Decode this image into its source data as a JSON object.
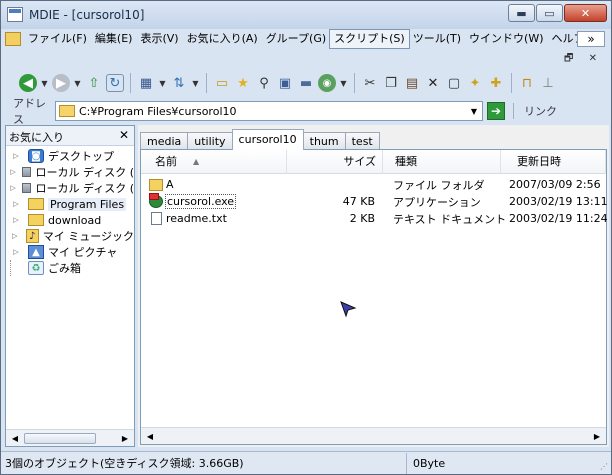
{
  "window": {
    "title": "MDIE - [cursorol10]",
    "buttons": {
      "minimize": "▬",
      "maximize": "▭",
      "close": "✕"
    }
  },
  "menu": {
    "items": [
      "ファイル(F)",
      "編集(E)",
      "表示(V)",
      "お気に入り(A)",
      "グループ(G)",
      "スクリプト(S)",
      "ツール(T)",
      "ウインドウ(W)",
      "ヘルプ(H)"
    ],
    "active_index": 5,
    "chevron": "»",
    "sub_buttons": "🗗 ✕"
  },
  "toolbar": {
    "icons": [
      "back-icon",
      "forward-icon",
      "up-folder-icon",
      "refresh-icon",
      "view-icon",
      "sort-icon",
      "folder-icon",
      "favorite-star-icon",
      "search-icon",
      "thumbnail-icon",
      "drive-icon",
      "network-icon",
      "cut-icon",
      "copy-icon",
      "paste-icon",
      "delete-icon",
      "properties-icon",
      "new-folder-icon",
      "bookmark-icon",
      "lock-icon",
      "pin-icon"
    ]
  },
  "address": {
    "label": "アドレス",
    "value": "C:¥Program Files¥cursorol10",
    "link_label": "リンク"
  },
  "left_pane": {
    "title": "お気に入り",
    "close": "✕",
    "tree": [
      {
        "label": "デスクトップ",
        "icon": "desktop-icon",
        "expandable": true
      },
      {
        "label": "ローカル ディスク (",
        "icon": "drive-icon",
        "expandable": true
      },
      {
        "label": "ローカル ディスク (",
        "icon": "drive-icon",
        "expandable": true
      },
      {
        "label": "Program Files",
        "icon": "folder-icon",
        "expandable": true,
        "selected": true
      },
      {
        "label": "download",
        "icon": "folder-icon",
        "expandable": true
      },
      {
        "label": "マイ ミュージック",
        "icon": "music-folder-icon",
        "expandable": true
      },
      {
        "label": "マイ ピクチャ",
        "icon": "picture-folder-icon",
        "expandable": true
      },
      {
        "label": "ごみ箱",
        "icon": "recycle-bin-icon",
        "expandable": false
      }
    ]
  },
  "tabs": [
    {
      "label": "media",
      "active": false
    },
    {
      "label": "utility",
      "active": false
    },
    {
      "label": "cursorol10",
      "active": true
    },
    {
      "label": "thum",
      "active": false
    },
    {
      "label": "test",
      "active": false
    }
  ],
  "file_list": {
    "columns": {
      "name": "名前",
      "size": "サイズ",
      "type": "種類",
      "date": "更新日時"
    },
    "rows": [
      {
        "name": "A",
        "size": "",
        "type": "ファイル フォルダ",
        "date": "2007/03/09 2:56",
        "icon": "folder-icon"
      },
      {
        "name": "cursorol.exe",
        "size": "47 KB",
        "type": "アプリケーション",
        "date": "2003/02/19 13:11",
        "icon": "exe-icon"
      },
      {
        "name": "readme.txt",
        "size": "2 KB",
        "type": "テキスト ドキュメント",
        "date": "2003/02/19 11:24",
        "icon": "text-file-icon"
      }
    ]
  },
  "status": {
    "left": "3個のオブジェクト(空きディスク領域: 3.66GB)",
    "size": "0Byte"
  }
}
